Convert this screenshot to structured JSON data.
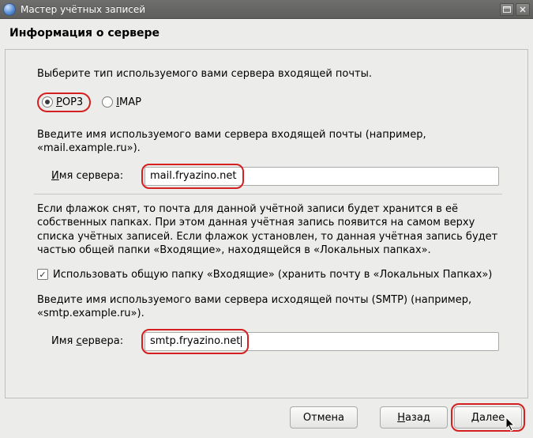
{
  "window": {
    "title": "Мастер учётных записей"
  },
  "heading": "Информация о сервере",
  "intro": "Выберите тип используемого вами сервера входящей почты.",
  "radio": {
    "pop_prefix": "P",
    "pop_rest": "OP3",
    "imap_prefix": "I",
    "imap_rest": "MAP",
    "selected": "pop3"
  },
  "incoming": {
    "help": "Введите имя используемого вами сервера входящей почты (например, «mail.example.ru»).",
    "label_prefix": "И",
    "label_rest": "мя сервера:",
    "value": "mail.fryazino.net"
  },
  "inbox_note": "Если флажок снят, то почта для данной учётной записи будет хранится в её собственных папках. При этом данная учётная запись появится на самом верху списка учётных записей. Если флажок установлен, то данная учётная запись будет частью общей папки «Входящие», находящейся в «Локальных папках».",
  "use_global_inbox": {
    "checked": true,
    "label": "Использовать общую папку «Входящие» (хранить почту в «Локальных Папках»)"
  },
  "outgoing": {
    "help": "Введите имя используемого вами сервера исходящей почты (SMTP) (например, «smtp.example.ru»).",
    "label_pre": "Имя ",
    "label_u": "с",
    "label_post": "ервера:",
    "value": "smtp.fryazino.net"
  },
  "buttons": {
    "cancel": "Отмена",
    "back_u": "Н",
    "back_rest": "азад",
    "next_u": "Д",
    "next_rest": "алее"
  }
}
